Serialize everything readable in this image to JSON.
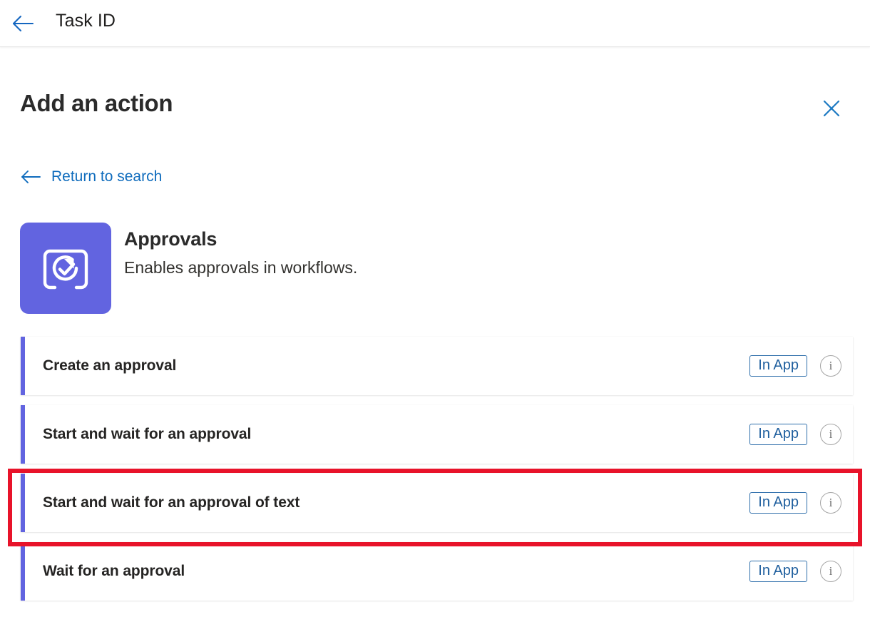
{
  "topbar": {
    "back_icon": "arrow-left-icon",
    "title": "Task ID"
  },
  "panel": {
    "title": "Add an action",
    "close_icon": "close-icon",
    "return_link": {
      "icon": "arrow-left-icon",
      "label": "Return to search"
    }
  },
  "connector": {
    "icon": "approvals-icon",
    "icon_color": "#6264e0",
    "name": "Approvals",
    "description": "Enables approvals in workflows."
  },
  "actions": [
    {
      "label": "Create an approval",
      "badge": "In App",
      "info_icon": "info-icon",
      "highlighted": false
    },
    {
      "label": "Start and wait for an approval",
      "badge": "In App",
      "info_icon": "info-icon",
      "highlighted": false
    },
    {
      "label": "Start and wait for an approval of text",
      "badge": "In App",
      "info_icon": "info-icon",
      "highlighted": true
    },
    {
      "label": "Wait for an approval",
      "badge": "In App",
      "info_icon": "info-icon",
      "highlighted": false
    }
  ],
  "annotation": {
    "color": "#e8132a",
    "target": "Start and wait for an approval of text"
  },
  "colors": {
    "link": "#0f6cbd",
    "accent": "#6264e0",
    "badge_text": "#1f5f9e",
    "highlight": "#e8132a"
  }
}
